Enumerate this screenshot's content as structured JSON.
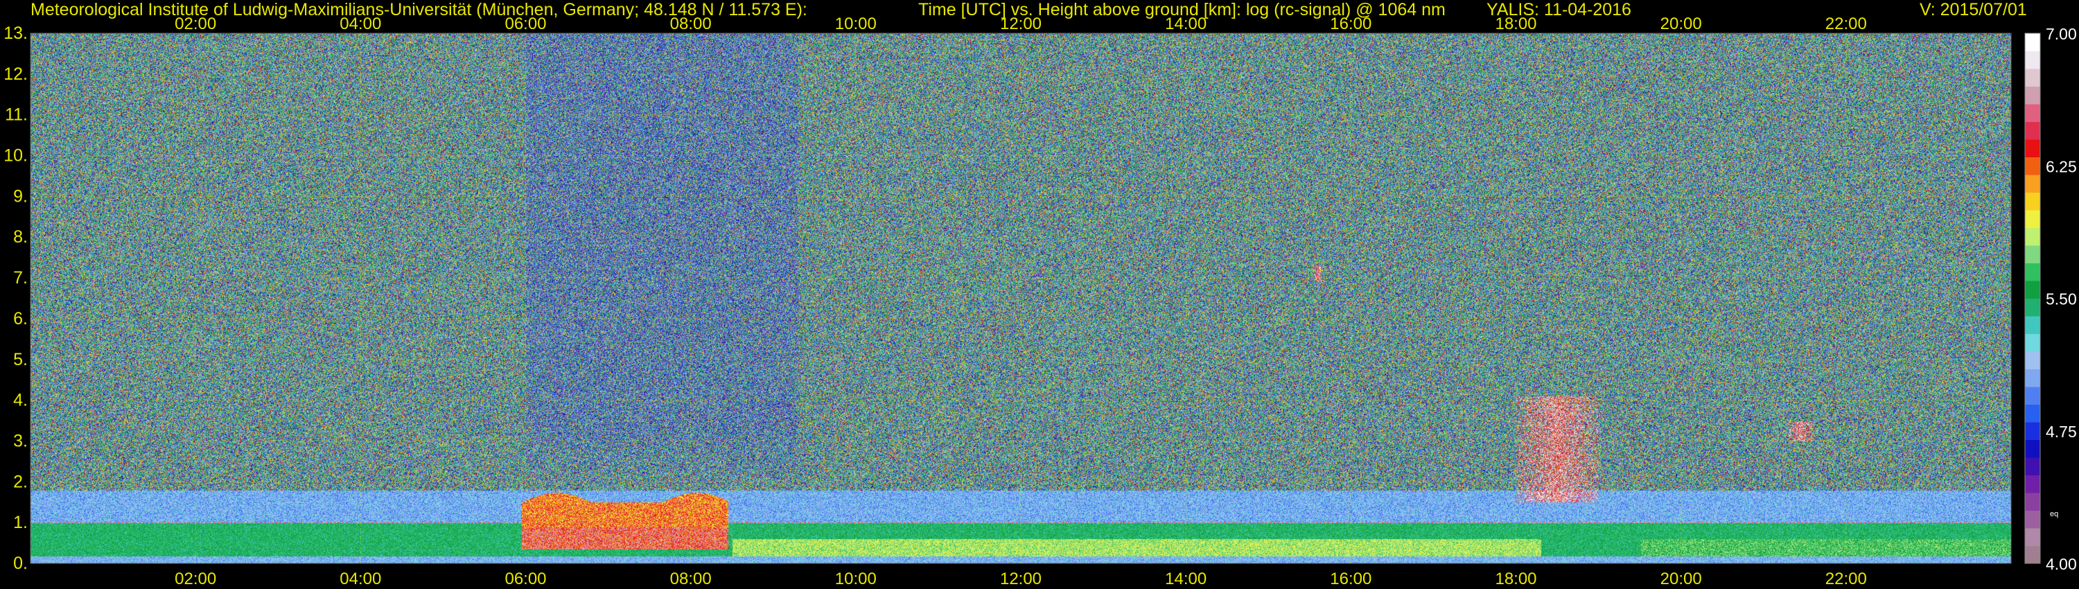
{
  "header": {
    "institute": "Meteorological Institute of Ludwig-Maximilians-Universität (München, Germany; 48.148 N / 11.573 E):",
    "description": "Time [UTC] vs. Height above ground [km]: log (rc-signal) @ 1064 nm",
    "station_date": "YALIS: 11-04-2016",
    "version": "V: 2015/07/01"
  },
  "chart_data": {
    "type": "heatmap",
    "title": "Time [UTC] vs. Height above ground [km]: log (rc-signal) @ 1064 nm",
    "x_tick_labels": [
      "02:00",
      "04:00",
      "06:00",
      "08:00",
      "10:00",
      "12:00",
      "14:00",
      "16:00",
      "18:00",
      "20:00",
      "22:00"
    ],
    "x_tick_hours": [
      2,
      4,
      6,
      8,
      10,
      12,
      14,
      16,
      18,
      20,
      22
    ],
    "xlim_hours_utc": [
      0,
      24
    ],
    "y_tick_labels": [
      "0.",
      "1.",
      "2.",
      "3.",
      "4.",
      "5.",
      "6.",
      "7.",
      "8.",
      "9.",
      "10.",
      "11.",
      "12.",
      "13."
    ],
    "ylim_km": [
      0,
      13
    ],
    "grid": true,
    "grid_style": "dotted yellow",
    "colorbar": {
      "min": 4.0,
      "max": 7.0,
      "tick_labels": [
        "7.00",
        "6.25",
        "5.50",
        "4.75",
        "4.00"
      ],
      "tick_values": [
        7.0,
        6.25,
        5.5,
        4.75,
        4.0
      ],
      "unit_label": "eq",
      "colors": [
        "#a08090",
        "#b088a8",
        "#9c60a0",
        "#8a40a0",
        "#7020a8",
        "#4010b0",
        "#1010c0",
        "#1830e0",
        "#2860f0",
        "#5080f0",
        "#80a8f0",
        "#a0c0f0",
        "#70d8e0",
        "#40c8c0",
        "#20b070",
        "#10a040",
        "#30c060",
        "#80d880",
        "#c0f070",
        "#f0f040",
        "#f8d020",
        "#f8a020",
        "#f06010",
        "#e81010",
        "#e03050",
        "#e06080",
        "#d0a0b0",
        "#e0c8d0",
        "#f0e8f0",
        "#ffffff"
      ]
    },
    "features": [
      {
        "name": "boundary_layer",
        "t_start": 0,
        "t_end": 24,
        "top_km": 1.0
      },
      {
        "name": "strong_aerosol_layer",
        "t_start": 5.95,
        "t_end": 8.45,
        "bottom_km": 0.35,
        "top_km": 1.5,
        "peak_km": 1.9
      },
      {
        "name": "cloud",
        "t_start": 18.0,
        "t_end": 19.0,
        "bottom_km": 1.5,
        "top_km": 4.1
      },
      {
        "name": "cloud",
        "t_start": 21.3,
        "t_end": 21.6,
        "bottom_km": 3.0,
        "top_km": 3.5
      },
      {
        "name": "cloud",
        "t_start": 15.55,
        "t_end": 15.65,
        "bottom_km": 6.9,
        "top_km": 7.3
      }
    ]
  }
}
